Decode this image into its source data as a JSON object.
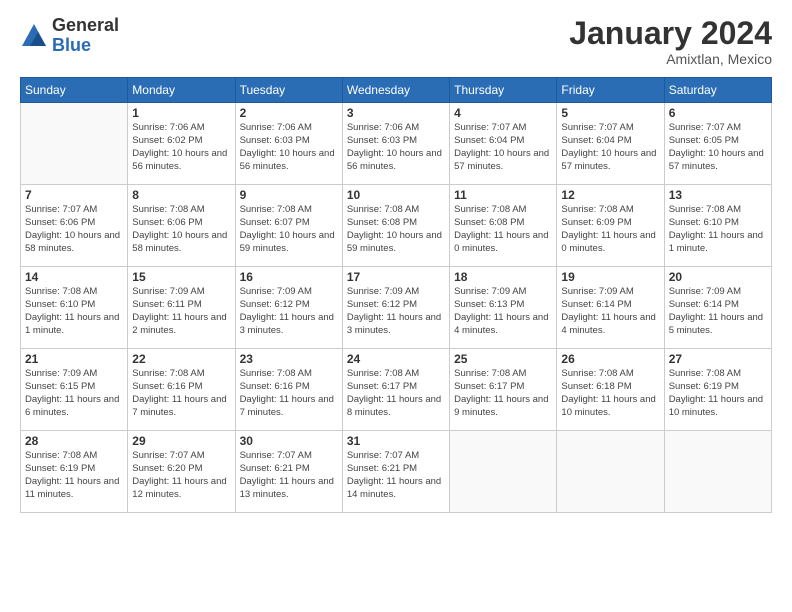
{
  "header": {
    "logo_general": "General",
    "logo_blue": "Blue",
    "month_title": "January 2024",
    "location": "Amixtlan, Mexico"
  },
  "weekdays": [
    "Sunday",
    "Monday",
    "Tuesday",
    "Wednesday",
    "Thursday",
    "Friday",
    "Saturday"
  ],
  "weeks": [
    [
      {
        "day": "",
        "empty": true
      },
      {
        "day": "1",
        "sunrise": "Sunrise: 7:06 AM",
        "sunset": "Sunset: 6:02 PM",
        "daylight": "Daylight: 10 hours and 56 minutes."
      },
      {
        "day": "2",
        "sunrise": "Sunrise: 7:06 AM",
        "sunset": "Sunset: 6:03 PM",
        "daylight": "Daylight: 10 hours and 56 minutes."
      },
      {
        "day": "3",
        "sunrise": "Sunrise: 7:06 AM",
        "sunset": "Sunset: 6:03 PM",
        "daylight": "Daylight: 10 hours and 56 minutes."
      },
      {
        "day": "4",
        "sunrise": "Sunrise: 7:07 AM",
        "sunset": "Sunset: 6:04 PM",
        "daylight": "Daylight: 10 hours and 57 minutes."
      },
      {
        "day": "5",
        "sunrise": "Sunrise: 7:07 AM",
        "sunset": "Sunset: 6:04 PM",
        "daylight": "Daylight: 10 hours and 57 minutes."
      },
      {
        "day": "6",
        "sunrise": "Sunrise: 7:07 AM",
        "sunset": "Sunset: 6:05 PM",
        "daylight": "Daylight: 10 hours and 57 minutes."
      }
    ],
    [
      {
        "day": "7",
        "sunrise": "Sunrise: 7:07 AM",
        "sunset": "Sunset: 6:06 PM",
        "daylight": "Daylight: 10 hours and 58 minutes."
      },
      {
        "day": "8",
        "sunrise": "Sunrise: 7:08 AM",
        "sunset": "Sunset: 6:06 PM",
        "daylight": "Daylight: 10 hours and 58 minutes."
      },
      {
        "day": "9",
        "sunrise": "Sunrise: 7:08 AM",
        "sunset": "Sunset: 6:07 PM",
        "daylight": "Daylight: 10 hours and 59 minutes."
      },
      {
        "day": "10",
        "sunrise": "Sunrise: 7:08 AM",
        "sunset": "Sunset: 6:08 PM",
        "daylight": "Daylight: 10 hours and 59 minutes."
      },
      {
        "day": "11",
        "sunrise": "Sunrise: 7:08 AM",
        "sunset": "Sunset: 6:08 PM",
        "daylight": "Daylight: 11 hours and 0 minutes."
      },
      {
        "day": "12",
        "sunrise": "Sunrise: 7:08 AM",
        "sunset": "Sunset: 6:09 PM",
        "daylight": "Daylight: 11 hours and 0 minutes."
      },
      {
        "day": "13",
        "sunrise": "Sunrise: 7:08 AM",
        "sunset": "Sunset: 6:10 PM",
        "daylight": "Daylight: 11 hours and 1 minute."
      }
    ],
    [
      {
        "day": "14",
        "sunrise": "Sunrise: 7:08 AM",
        "sunset": "Sunset: 6:10 PM",
        "daylight": "Daylight: 11 hours and 1 minute."
      },
      {
        "day": "15",
        "sunrise": "Sunrise: 7:09 AM",
        "sunset": "Sunset: 6:11 PM",
        "daylight": "Daylight: 11 hours and 2 minutes."
      },
      {
        "day": "16",
        "sunrise": "Sunrise: 7:09 AM",
        "sunset": "Sunset: 6:12 PM",
        "daylight": "Daylight: 11 hours and 3 minutes."
      },
      {
        "day": "17",
        "sunrise": "Sunrise: 7:09 AM",
        "sunset": "Sunset: 6:12 PM",
        "daylight": "Daylight: 11 hours and 3 minutes."
      },
      {
        "day": "18",
        "sunrise": "Sunrise: 7:09 AM",
        "sunset": "Sunset: 6:13 PM",
        "daylight": "Daylight: 11 hours and 4 minutes."
      },
      {
        "day": "19",
        "sunrise": "Sunrise: 7:09 AM",
        "sunset": "Sunset: 6:14 PM",
        "daylight": "Daylight: 11 hours and 4 minutes."
      },
      {
        "day": "20",
        "sunrise": "Sunrise: 7:09 AM",
        "sunset": "Sunset: 6:14 PM",
        "daylight": "Daylight: 11 hours and 5 minutes."
      }
    ],
    [
      {
        "day": "21",
        "sunrise": "Sunrise: 7:09 AM",
        "sunset": "Sunset: 6:15 PM",
        "daylight": "Daylight: 11 hours and 6 minutes."
      },
      {
        "day": "22",
        "sunrise": "Sunrise: 7:08 AM",
        "sunset": "Sunset: 6:16 PM",
        "daylight": "Daylight: 11 hours and 7 minutes."
      },
      {
        "day": "23",
        "sunrise": "Sunrise: 7:08 AM",
        "sunset": "Sunset: 6:16 PM",
        "daylight": "Daylight: 11 hours and 7 minutes."
      },
      {
        "day": "24",
        "sunrise": "Sunrise: 7:08 AM",
        "sunset": "Sunset: 6:17 PM",
        "daylight": "Daylight: 11 hours and 8 minutes."
      },
      {
        "day": "25",
        "sunrise": "Sunrise: 7:08 AM",
        "sunset": "Sunset: 6:17 PM",
        "daylight": "Daylight: 11 hours and 9 minutes."
      },
      {
        "day": "26",
        "sunrise": "Sunrise: 7:08 AM",
        "sunset": "Sunset: 6:18 PM",
        "daylight": "Daylight: 11 hours and 10 minutes."
      },
      {
        "day": "27",
        "sunrise": "Sunrise: 7:08 AM",
        "sunset": "Sunset: 6:19 PM",
        "daylight": "Daylight: 11 hours and 10 minutes."
      }
    ],
    [
      {
        "day": "28",
        "sunrise": "Sunrise: 7:08 AM",
        "sunset": "Sunset: 6:19 PM",
        "daylight": "Daylight: 11 hours and 11 minutes."
      },
      {
        "day": "29",
        "sunrise": "Sunrise: 7:07 AM",
        "sunset": "Sunset: 6:20 PM",
        "daylight": "Daylight: 11 hours and 12 minutes."
      },
      {
        "day": "30",
        "sunrise": "Sunrise: 7:07 AM",
        "sunset": "Sunset: 6:21 PM",
        "daylight": "Daylight: 11 hours and 13 minutes."
      },
      {
        "day": "31",
        "sunrise": "Sunrise: 7:07 AM",
        "sunset": "Sunset: 6:21 PM",
        "daylight": "Daylight: 11 hours and 14 minutes."
      },
      {
        "day": "",
        "empty": true
      },
      {
        "day": "",
        "empty": true
      },
      {
        "day": "",
        "empty": true
      }
    ]
  ]
}
